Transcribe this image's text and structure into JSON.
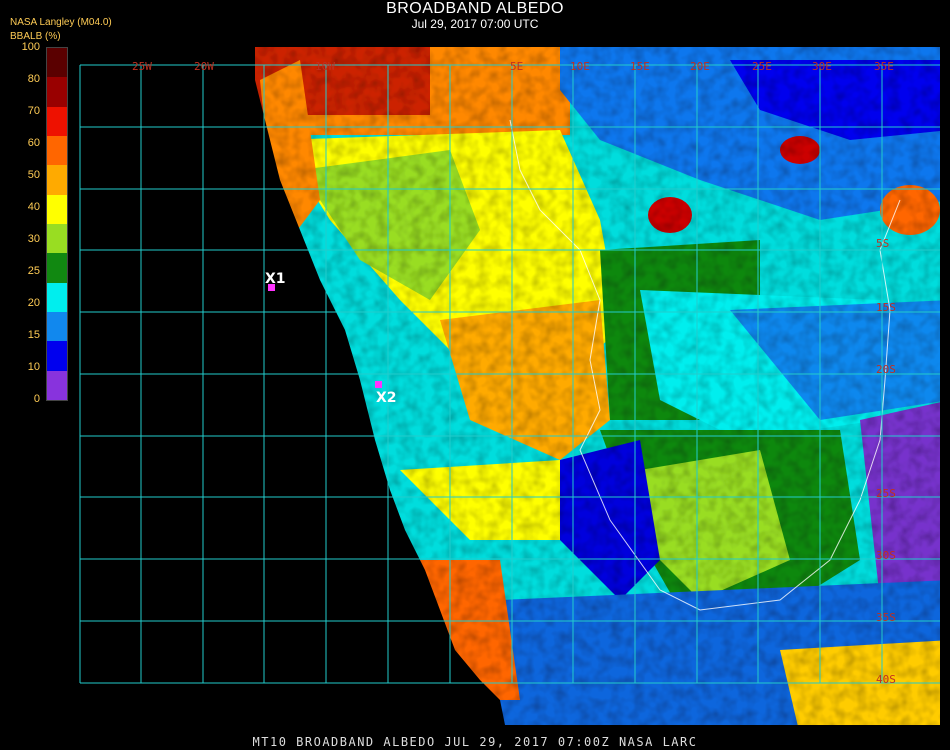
{
  "header": {
    "title": "BROADBAND ALBEDO",
    "subtitle": "Jul 29, 2017 07:00 UTC",
    "source": "NASA Langley (M04.0)",
    "legend_label": "BBALB (%)"
  },
  "legend": {
    "ticks": [
      "100",
      "80",
      "70",
      "60",
      "50",
      "40",
      "30",
      "25",
      "20",
      "15",
      "10",
      "0"
    ],
    "colors": [
      "#5a0000",
      "#990000",
      "#ee1100",
      "#ff6600",
      "#ffaa00",
      "#ffff00",
      "#99dd22",
      "#118811",
      "#00eeee",
      "#1188ee",
      "#0000ee",
      "#8833dd"
    ]
  },
  "grid": {
    "lon_labels": [
      "25W",
      "20W",
      "10W",
      "5E",
      "10E",
      "15E",
      "20E",
      "25E",
      "30E",
      "35E"
    ],
    "lat_labels": [
      "5S",
      "15S",
      "20S",
      "25S",
      "30S",
      "35S",
      "40S"
    ]
  },
  "markers": [
    {
      "label": "X1",
      "color": "#ff33ff"
    },
    {
      "label": "X2",
      "color": "#ff33ff"
    }
  ],
  "footer": {
    "text": "MT10  BROADBAND ALBEDO   JUL 29, 2017 07:00Z   NASA LARC"
  }
}
